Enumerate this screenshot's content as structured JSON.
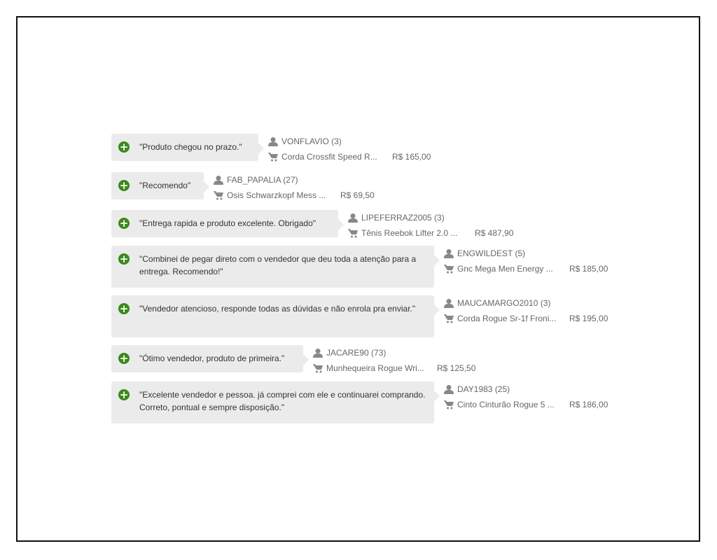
{
  "feedback": [
    {
      "comment": "\"Produto chegou no prazo.\"",
      "user": "VONFLAVIO (3)",
      "product": "Corda Crossfit Speed R...",
      "price": "R$ 165,00"
    },
    {
      "comment": "\"Recomendo\"",
      "user": "FAB_PAPALIA (27)",
      "product": "Osis Schwarzkopf Mess ...",
      "price": "R$ 69,50"
    },
    {
      "comment": "\"Entrega rapida e produto excelente. Obrigado\"",
      "user": "LIPEFERRAZ2005 (3)",
      "product": "Tênis Reebok Lifter 2.0 ...",
      "price": "R$ 487,90"
    },
    {
      "comment": "\"Combinei de pegar direto com o vendedor que deu toda a atenção para a entrega. Recomendo!\"",
      "user": "ENGWILDEST (5)",
      "product": "Gnc Mega Men Energy ...",
      "price": "R$ 185,00"
    },
    {
      "comment": "\"Vendedor atencioso, responde todas as dúvidas e não enrola pra enviar.\"",
      "user": "MAUCAMARGO2010 (3)",
      "product": "Corda Rogue Sr-1f Froni...",
      "price": "R$ 195,00"
    },
    {
      "comment": "\"Ótimo vendedor, produto de primeira.\"",
      "user": "JACARE90 (73)",
      "product": "Munhequeira Rogue Wri...",
      "price": "R$ 125,50"
    },
    {
      "comment": "\"Excelente vendedor e pessoa. já comprei com ele e continuarei comprando. Correto, pontual e sempre disposição.\"",
      "user": "DAY1983 (25)",
      "product": "Cinto Cinturão Rogue 5 ...",
      "price": "R$ 186,00"
    }
  ],
  "icons": {
    "positive": "plus-circle-icon",
    "user": "user-icon",
    "product": "cart-icon"
  },
  "colors": {
    "positive": "#3a8a1a",
    "bubble": "#ebebeb"
  }
}
